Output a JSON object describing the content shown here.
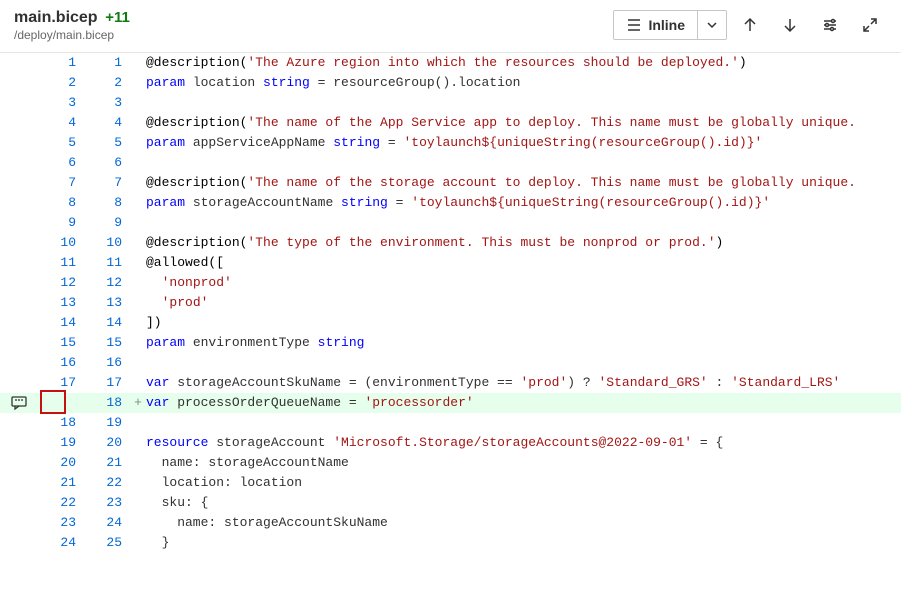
{
  "header": {
    "filename": "main.bicep",
    "change_badge": "+11",
    "path": "/deploy/main.bicep",
    "view_mode": "Inline"
  },
  "icons": {
    "list": "list-icon",
    "chevron_down": "chevron-down-icon",
    "arrow_up": "arrow-up-icon",
    "arrow_down": "arrow-down-icon",
    "settings": "settings-icon",
    "expand": "expand-icon",
    "comment": "comment-icon"
  },
  "code": {
    "lines": [
      {
        "old": "1",
        "new": "1",
        "mark": "",
        "html": "<span class='tok-at'>@description(</span><span class='tok-str'>'The Azure region into which the resources should be deployed.'</span><span class='tok-at'>)</span>"
      },
      {
        "old": "2",
        "new": "2",
        "mark": "",
        "html": "<span class='tok-kw'>param</span> location <span class='tok-kw'>string</span> = resourceGroup().location"
      },
      {
        "old": "3",
        "new": "3",
        "mark": "",
        "html": ""
      },
      {
        "old": "4",
        "new": "4",
        "mark": "",
        "html": "<span class='tok-at'>@description(</span><span class='tok-str'>'The name of the App Service app to deploy. This name must be globally unique.</span>"
      },
      {
        "old": "5",
        "new": "5",
        "mark": "",
        "html": "<span class='tok-kw'>param</span> appServiceAppName <span class='tok-kw'>string</span> = <span class='tok-str'>'toylaunch${uniqueString(resourceGroup().id)}'</span>"
      },
      {
        "old": "6",
        "new": "6",
        "mark": "",
        "html": ""
      },
      {
        "old": "7",
        "new": "7",
        "mark": "",
        "html": "<span class='tok-at'>@description(</span><span class='tok-str'>'The name of the storage account to deploy. This name must be globally unique.</span>"
      },
      {
        "old": "8",
        "new": "8",
        "mark": "",
        "html": "<span class='tok-kw'>param</span> storageAccountName <span class='tok-kw'>string</span> = <span class='tok-str'>'toylaunch${uniqueString(resourceGroup().id)}'</span>"
      },
      {
        "old": "9",
        "new": "9",
        "mark": "",
        "html": ""
      },
      {
        "old": "10",
        "new": "10",
        "mark": "",
        "html": "<span class='tok-at'>@description(</span><span class='tok-str'>'The type of the environment. This must be nonprod or prod.'</span><span class='tok-at'>)</span>"
      },
      {
        "old": "11",
        "new": "11",
        "mark": "",
        "html": "<span class='tok-at'>@allowed([</span>"
      },
      {
        "old": "12",
        "new": "12",
        "mark": "",
        "html": "  <span class='tok-str'>'nonprod'</span>"
      },
      {
        "old": "13",
        "new": "13",
        "mark": "",
        "html": "  <span class='tok-str'>'prod'</span>"
      },
      {
        "old": "14",
        "new": "14",
        "mark": "",
        "html": "<span class='tok-at'>])</span>"
      },
      {
        "old": "15",
        "new": "15",
        "mark": "",
        "html": "<span class='tok-kw'>param</span> environmentType <span class='tok-kw'>string</span>"
      },
      {
        "old": "16",
        "new": "16",
        "mark": "",
        "html": ""
      },
      {
        "old": "17",
        "new": "17",
        "mark": "",
        "html": "<span class='tok-kw'>var</span> storageAccountSkuName = (environmentType == <span class='tok-str'>'prod'</span>) ? <span class='tok-str'>'Standard_GRS'</span> : <span class='tok-str'>'Standard_LRS'</span>"
      },
      {
        "old": "",
        "new": "18",
        "mark": "+",
        "added": true,
        "comment": true,
        "html": "<span class='tok-kw'>var</span> processOrderQueueName = <span class='tok-str'>'processorder'</span>"
      },
      {
        "old": "18",
        "new": "19",
        "mark": "",
        "html": ""
      },
      {
        "old": "19",
        "new": "20",
        "mark": "",
        "html": "<span class='tok-kw'>resource</span> storageAccount <span class='tok-str'>'Microsoft.Storage/storageAccounts@2022-09-01'</span> = {"
      },
      {
        "old": "20",
        "new": "21",
        "mark": "",
        "html": "  name: storageAccountName"
      },
      {
        "old": "21",
        "new": "22",
        "mark": "",
        "html": "  location: location"
      },
      {
        "old": "22",
        "new": "23",
        "mark": "",
        "html": "  sku: {"
      },
      {
        "old": "23",
        "new": "24",
        "mark": "",
        "html": "    name: storageAccountSkuName"
      },
      {
        "old": "24",
        "new": "25",
        "mark": "",
        "html": "  }"
      }
    ]
  }
}
